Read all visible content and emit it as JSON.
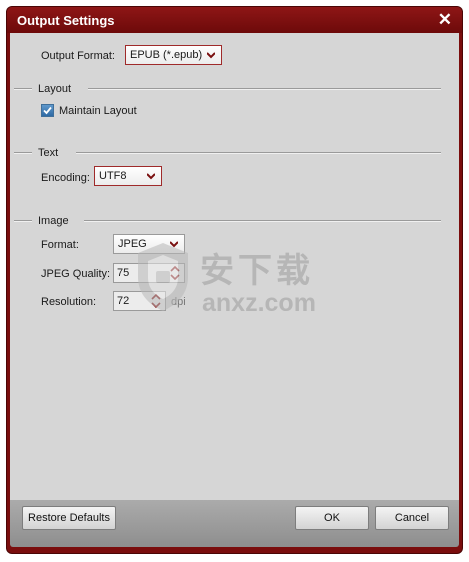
{
  "window": {
    "title": "Output Settings",
    "close_label": "✕"
  },
  "output_format": {
    "label": "Output Format:",
    "value": "EPUB (*.epub)"
  },
  "layout": {
    "section_label": "Layout",
    "maintain_layout_label": "Maintain Layout",
    "maintain_layout_checked": true
  },
  "text": {
    "section_label": "Text",
    "encoding_label": "Encoding:",
    "encoding_value": "UTF8"
  },
  "image": {
    "section_label": "Image",
    "format_label": "Format:",
    "format_value": "JPEG",
    "quality_label": "JPEG Quality:",
    "quality_value": "75",
    "resolution_label": "Resolution:",
    "resolution_value": "72",
    "resolution_unit": "dpi"
  },
  "footer": {
    "restore_label": "Restore Defaults",
    "ok_label": "OK",
    "cancel_label": "Cancel"
  },
  "watermark": {
    "chinese_text": "安下载",
    "domain_text": "anxz.com"
  },
  "colors": {
    "frame": "#7a0d0d",
    "title_bar": "#8e1616",
    "content_bg": "#d6d6d6",
    "checkbox": "#3a78b5"
  },
  "icons": {
    "close": "close-icon",
    "dropdown": "chevron-down-icon",
    "spinner": "spinner-arrows-icon",
    "checkbox": "checkmark-icon",
    "watermark": "shield-logo-icon"
  }
}
